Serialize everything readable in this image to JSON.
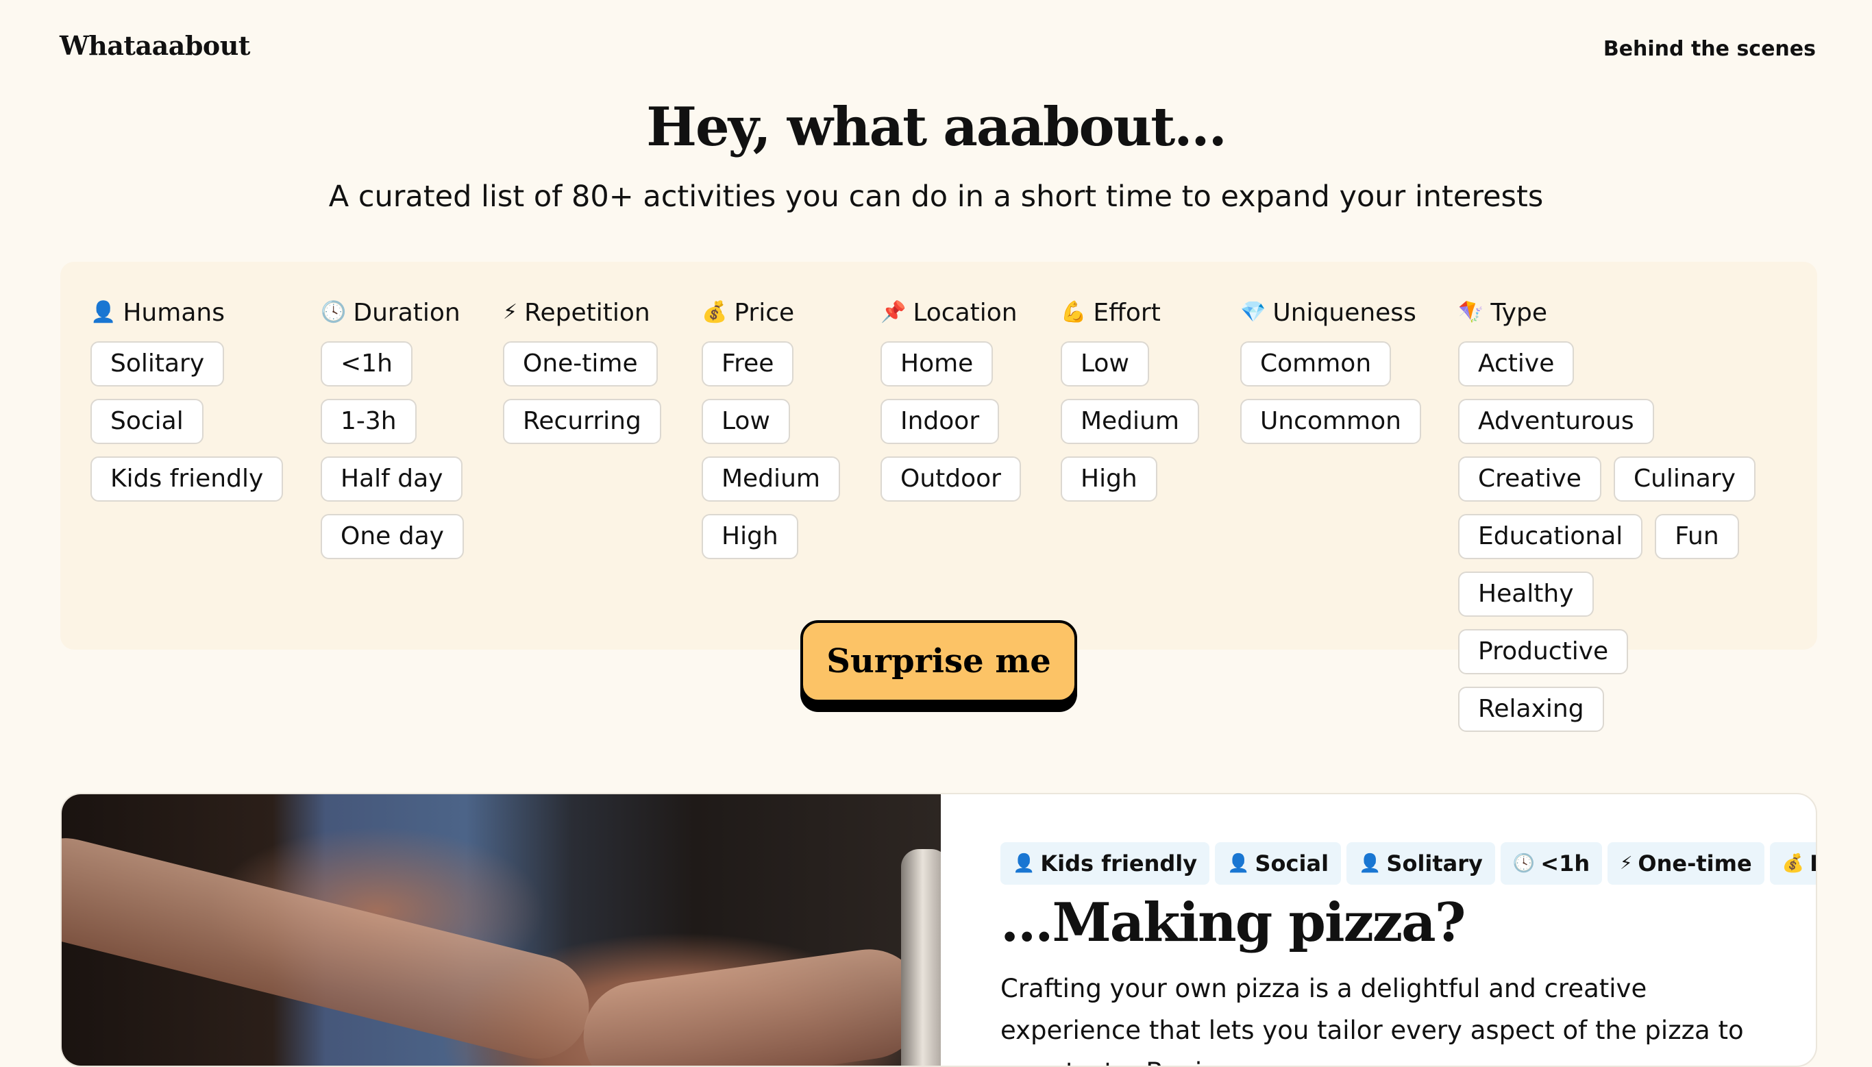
{
  "header": {
    "brand": "Whataaabout",
    "nav_link": "Behind the scenes"
  },
  "hero": {
    "title": "Hey, what aaabout...",
    "subtitle": "A curated list of 80+ activities you can do in a short time to expand your interests"
  },
  "filters": {
    "groups": [
      {
        "icon": "👤",
        "icon_name": "person-icon",
        "title": "Humans",
        "options": [
          "Solitary",
          "Social",
          "Kids friendly"
        ]
      },
      {
        "icon": "🕓",
        "icon_name": "clock-icon",
        "title": "Duration",
        "options": [
          "<1h",
          "1-3h",
          "Half day",
          "One day"
        ]
      },
      {
        "icon": "⚡",
        "icon_name": "lightning-icon",
        "title": "Repetition",
        "options": [
          "One-time",
          "Recurring"
        ]
      },
      {
        "icon": "💰",
        "icon_name": "money-bag-icon",
        "title": "Price",
        "options": [
          "Free",
          "Low",
          "Medium",
          "High"
        ]
      },
      {
        "icon": "📌",
        "icon_name": "pin-icon",
        "title": "Location",
        "options": [
          "Home",
          "Indoor",
          "Outdoor"
        ]
      },
      {
        "icon": "💪",
        "icon_name": "flexed-biceps-icon",
        "title": "Effort",
        "options": [
          "Low",
          "Medium",
          "High"
        ]
      },
      {
        "icon": "💎",
        "icon_name": "gem-icon",
        "title": "Uniqueness",
        "options": [
          "Common",
          "Uncommon"
        ]
      },
      {
        "icon": "🪁",
        "icon_name": "kite-icon",
        "title": "Type",
        "options": [
          "Active",
          "Adventurous",
          "Creative",
          "Culinary",
          "Educational",
          "Fun",
          "Healthy",
          "Productive",
          "Relaxing"
        ]
      }
    ]
  },
  "cta": {
    "label": "Surprise me",
    "color": "#fcc366"
  },
  "activity": {
    "tags": [
      {
        "icon": "👤",
        "label": "Kids friendly"
      },
      {
        "icon": "👤",
        "label": "Social"
      },
      {
        "icon": "👤",
        "label": "Solitary"
      },
      {
        "icon": "🕓",
        "label": "<1h"
      },
      {
        "icon": "⚡",
        "label": "One-time"
      },
      {
        "icon": "💰",
        "label": "Low"
      }
    ],
    "title": "...Making pizza?",
    "description": "Crafting your own pizza is a delightful and creative experience that lets you tailor every aspect of the pizza to your taste. Begin"
  },
  "colors": {
    "background": "#fdf9f1",
    "filter_panel": "#fcf4e5",
    "tag_background": "#ebf5fb"
  }
}
